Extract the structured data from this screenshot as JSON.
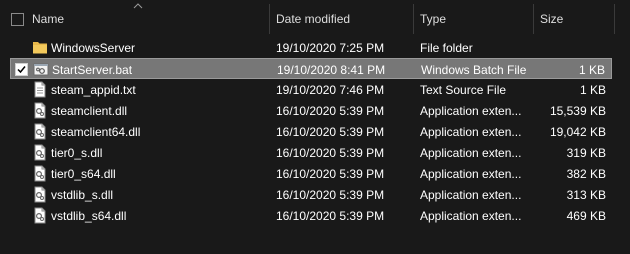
{
  "columns": {
    "name": "Name",
    "date": "Date modified",
    "type": "Type",
    "size": "Size"
  },
  "files": [
    {
      "name": "WindowsServer",
      "date": "19/10/2020 7:25 PM",
      "type": "File folder",
      "size": "",
      "icon": "folder-icon",
      "selected": false
    },
    {
      "name": "StartServer.bat",
      "date": "19/10/2020 8:41 PM",
      "type": "Windows Batch File",
      "size": "1 KB",
      "icon": "batch-file-icon",
      "selected": true
    },
    {
      "name": "steam_appid.txt",
      "date": "19/10/2020 7:46 PM",
      "type": "Text Source File",
      "size": "1 KB",
      "icon": "text-file-icon",
      "selected": false
    },
    {
      "name": "steamclient.dll",
      "date": "16/10/2020 5:39 PM",
      "type": "Application exten...",
      "size": "15,539 KB",
      "icon": "dll-file-icon",
      "selected": false
    },
    {
      "name": "steamclient64.dll",
      "date": "16/10/2020 5:39 PM",
      "type": "Application exten...",
      "size": "19,042 KB",
      "icon": "dll-file-icon",
      "selected": false
    },
    {
      "name": "tier0_s.dll",
      "date": "16/10/2020 5:39 PM",
      "type": "Application exten...",
      "size": "319 KB",
      "icon": "dll-file-icon",
      "selected": false
    },
    {
      "name": "tier0_s64.dll",
      "date": "16/10/2020 5:39 PM",
      "type": "Application exten...",
      "size": "382 KB",
      "icon": "dll-file-icon",
      "selected": false
    },
    {
      "name": "vstdlib_s.dll",
      "date": "16/10/2020 5:39 PM",
      "type": "Application exten...",
      "size": "313 KB",
      "icon": "dll-file-icon",
      "selected": false
    },
    {
      "name": "vstdlib_s64.dll",
      "date": "16/10/2020 5:39 PM",
      "type": "Application exten...",
      "size": "469 KB",
      "icon": "dll-file-icon",
      "selected": false
    }
  ],
  "colors": {
    "background": "#191919",
    "selected_row": "#777777",
    "folder": "#e8b84a"
  }
}
